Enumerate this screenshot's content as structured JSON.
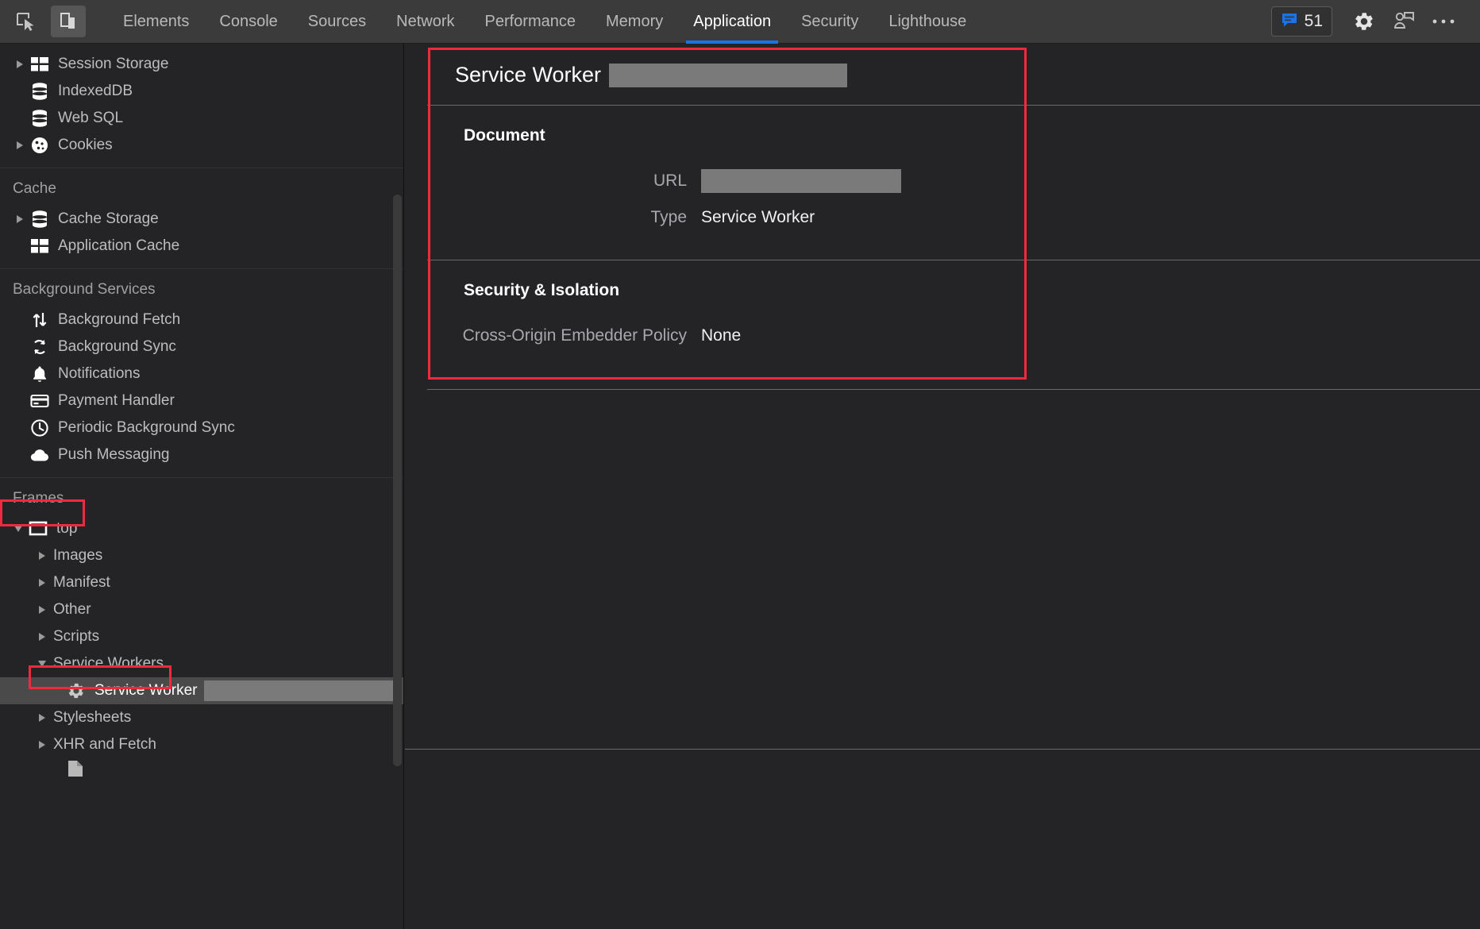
{
  "toolbar": {
    "inspect_icon": "inspect-cursor-icon",
    "device_icon": "device-toggle-icon",
    "tabs": [
      {
        "label": "Elements",
        "active": false
      },
      {
        "label": "Console",
        "active": false
      },
      {
        "label": "Sources",
        "active": false
      },
      {
        "label": "Network",
        "active": false
      },
      {
        "label": "Performance",
        "active": false
      },
      {
        "label": "Memory",
        "active": false
      },
      {
        "label": "Application",
        "active": true
      },
      {
        "label": "Security",
        "active": false
      },
      {
        "label": "Lighthouse",
        "active": false
      }
    ],
    "message_count": "51",
    "settings_icon": "gear-icon",
    "drawer_icon": "customize-devtools-icon",
    "more_icon": "more-options-icon",
    "accent_color": "#1a73e8"
  },
  "sidebar": {
    "storage": {
      "items": [
        {
          "label": "Session Storage",
          "icon": "table-icon",
          "twisty": "right"
        },
        {
          "label": "IndexedDB",
          "icon": "database-icon",
          "twisty": "none"
        },
        {
          "label": "Web SQL",
          "icon": "database-icon",
          "twisty": "none"
        },
        {
          "label": "Cookies",
          "icon": "cookie-icon",
          "twisty": "right"
        }
      ]
    },
    "cache": {
      "header": "Cache",
      "items": [
        {
          "label": "Cache Storage",
          "icon": "database-icon",
          "twisty": "right"
        },
        {
          "label": "Application Cache",
          "icon": "table-icon",
          "twisty": "none"
        }
      ]
    },
    "background_services": {
      "header": "Background Services",
      "items": [
        {
          "label": "Background Fetch",
          "icon": "arrows-updown-icon",
          "twisty": "none"
        },
        {
          "label": "Background Sync",
          "icon": "sync-icon",
          "twisty": "none"
        },
        {
          "label": "Notifications",
          "icon": "bell-icon",
          "twisty": "none"
        },
        {
          "label": "Payment Handler",
          "icon": "credit-card-icon",
          "twisty": "none"
        },
        {
          "label": "Periodic Background Sync",
          "icon": "clock-icon",
          "twisty": "none"
        },
        {
          "label": "Push Messaging",
          "icon": "cloud-icon",
          "twisty": "none"
        }
      ]
    },
    "frames": {
      "header": "Frames",
      "top_frame": "top",
      "children": [
        {
          "label": "Images",
          "twisty": "right"
        },
        {
          "label": "Manifest",
          "twisty": "right"
        },
        {
          "label": "Other",
          "twisty": "right"
        },
        {
          "label": "Scripts",
          "twisty": "right"
        },
        {
          "label": "Service Workers",
          "twisty": "down",
          "highlighted": true
        }
      ],
      "service_worker_item": {
        "label": "Service Worker",
        "icon": "gear-icon",
        "redacted_value": "",
        "selected": true
      },
      "after_items": [
        {
          "label": "Stylesheets",
          "twisty": "right"
        },
        {
          "label": "XHR and Fetch",
          "twisty": "right"
        }
      ],
      "cut_off_item": {
        "label": "",
        "icon": "document-icon"
      }
    }
  },
  "main": {
    "title": "Service Worker",
    "title_redacted_value": "",
    "sections": [
      {
        "heading": "Document",
        "rows": [
          {
            "key": "URL",
            "value": "",
            "redacted": true
          },
          {
            "key": "Type",
            "value": "Service Worker",
            "redacted": false
          }
        ]
      },
      {
        "heading": "Security & Isolation",
        "rows": [
          {
            "key": "Cross-Origin Embedder Policy",
            "value": "None",
            "redacted": false
          }
        ]
      }
    ]
  },
  "annotations": {
    "color": "#f02a3e",
    "boxes": [
      {
        "name": "frames-label-highlight"
      },
      {
        "name": "service-workers-row-highlight"
      },
      {
        "name": "service-worker-report-highlight"
      }
    ]
  }
}
